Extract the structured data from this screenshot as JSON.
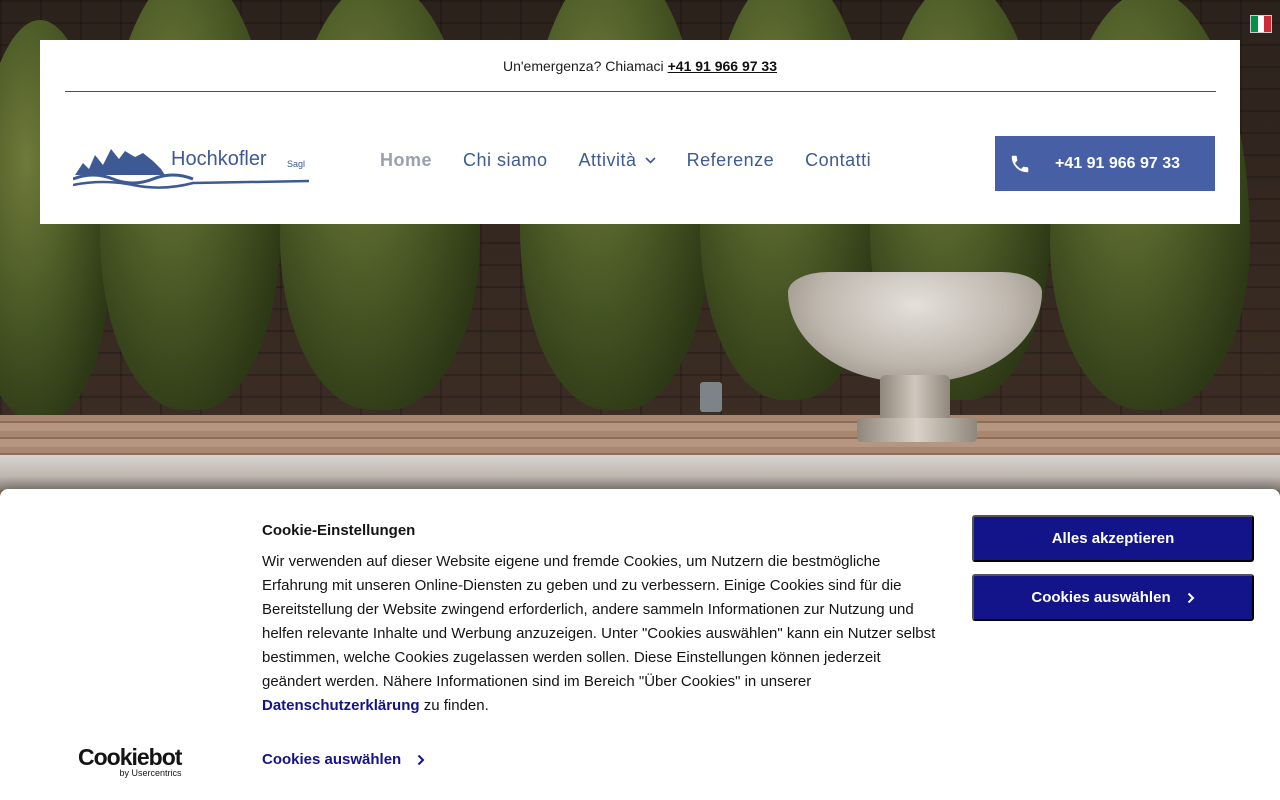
{
  "language_flag": {
    "icon": "italy-flag-icon",
    "colors": [
      "#009246",
      "#ffffff",
      "#ce2b37"
    ]
  },
  "topbar": {
    "text": "Un'emergenza? Chiamaci",
    "phone": "+41 91 966 97 33"
  },
  "logo": {
    "text": "Hochkofler",
    "suffix": "Sagl",
    "color": "#3d5a94"
  },
  "nav": {
    "items": [
      {
        "label": "Home",
        "active": true
      },
      {
        "label": "Chi siamo"
      },
      {
        "label": "Attività",
        "has_dropdown": true
      },
      {
        "label": "Referenze"
      },
      {
        "label": "Contatti"
      }
    ]
  },
  "call_button": {
    "label": "+41 91 966 97 33",
    "icon": "phone-icon",
    "color": "#4760a5"
  },
  "cookie_banner": {
    "title": "Cookie-Einstellungen",
    "body": "Wir verwenden auf dieser Website eigene und fremde Cookies, um Nutzern die bestmögliche Erfahrung mit unseren Online-Diensten zu geben und zu verbessern. Einige Cookies sind für die Bereitstellung der Website zwingend erforderlich, andere sammeln Informationen zur Nutzung und helfen relevante Inhalte und Werbung anzuzeigen. Unter \"Cookies auswählen\" kann ein Nutzer selbst bestimmen, welche Cookies zugelassen werden sollen. Diese Einstellungen können jederzeit geändert werden. Nähere Informationen sind im Bereich \"Über Cookies\" in unserer",
    "privacy_link": "Datenschutzerklärung",
    "body_end": "zu finden.",
    "select_link": "Cookies auswählen",
    "accept_all": "Alles akzeptieren",
    "select_button": "Cookies auswählen",
    "button_color": "#14148a",
    "brand": "Cookiebot",
    "brand_by": "by Usercentrics"
  }
}
